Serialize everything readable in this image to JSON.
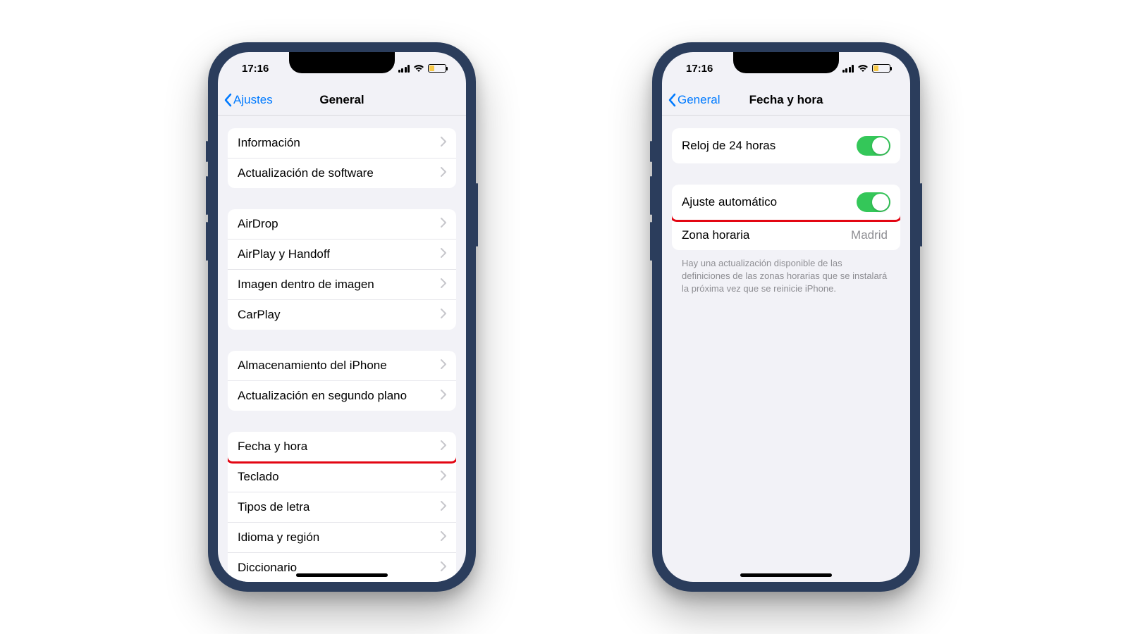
{
  "status": {
    "time": "17:16"
  },
  "left": {
    "back": "Ajustes",
    "title": "General",
    "g1": [
      {
        "label": "Información"
      },
      {
        "label": "Actualización de software"
      }
    ],
    "g2": [
      {
        "label": "AirDrop"
      },
      {
        "label": "AirPlay y Handoff"
      },
      {
        "label": "Imagen dentro de imagen"
      },
      {
        "label": "CarPlay"
      }
    ],
    "g3": [
      {
        "label": "Almacenamiento del iPhone"
      },
      {
        "label": "Actualización en segundo plano"
      }
    ],
    "g4": [
      {
        "label": "Fecha y hora",
        "highlight": true
      },
      {
        "label": "Teclado"
      },
      {
        "label": "Tipos de letra"
      },
      {
        "label": "Idioma y región"
      },
      {
        "label": "Diccionario"
      }
    ]
  },
  "right": {
    "back": "General",
    "title": "Fecha y hora",
    "g1": [
      {
        "label": "Reloj de 24 horas",
        "toggle": true
      }
    ],
    "g2": [
      {
        "label": "Ajuste automático",
        "toggle": true,
        "highlight": true
      },
      {
        "label": "Zona horaria",
        "value": "Madrid"
      }
    ],
    "footer": "Hay una actualización disponible de las definiciones de las zonas horarias que se instalará la próxima vez que se reinicie iPhone."
  }
}
